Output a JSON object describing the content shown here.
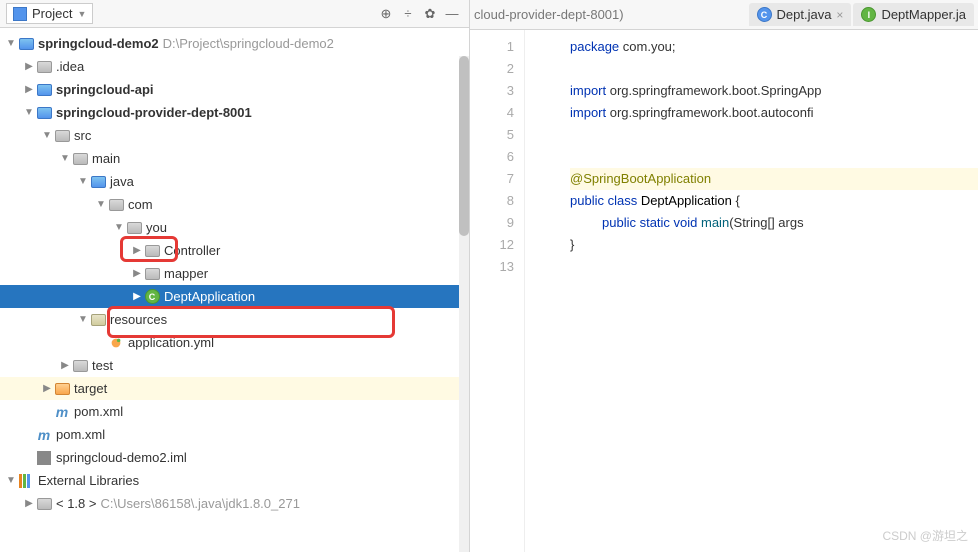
{
  "toolbar": {
    "title": "Project",
    "dropdown": "▼"
  },
  "tree": {
    "root": {
      "name": "springcloud-demo2",
      "path": "D:\\Project\\springcloud-demo2"
    },
    "idea": ".idea",
    "api": "springcloud-api",
    "provider": "springcloud-provider-dept-8001",
    "src": "src",
    "main": "main",
    "java": "java",
    "com": "com",
    "you": "you",
    "controller": "Controller",
    "mapper": "mapper",
    "deptapp": "DeptApplication",
    "resources": "resources",
    "appyml": "application.yml",
    "test": "test",
    "target": "target",
    "pom1": "pom.xml",
    "pom2": "pom.xml",
    "iml": "springcloud-demo2.iml",
    "ext": "External Libraries",
    "jdk": {
      "name": "< 1.8 >",
      "path": "C:\\Users\\86158\\.java\\jdk1.8.0_271"
    }
  },
  "tabs": {
    "bc": "cloud-provider-dept-8001)",
    "t1": "Dept.java",
    "t2": "DeptMapper.ja"
  },
  "code": {
    "l1": {
      "kw": "package",
      "txt": " com.you;"
    },
    "l3": {
      "kw": "import",
      "txt": " org.springframework.boot.SpringApp"
    },
    "l4": {
      "kw": "import",
      "txt": " org.springframework.boot.autoconfi"
    },
    "l7": {
      "ann": "@SpringBootApplication"
    },
    "l8": {
      "kw1": "public class",
      "cls": " DeptApplication ",
      "br": "{"
    },
    "l9": {
      "kw1": "public static void",
      "mth": " main",
      "args": "(String[] args"
    },
    "l12": "}"
  },
  "lines": [
    "1",
    "2",
    "3",
    "4",
    "5",
    "6",
    "7",
    "8",
    "9",
    "12",
    "13"
  ],
  "watermark": "CSDN @游坦之"
}
